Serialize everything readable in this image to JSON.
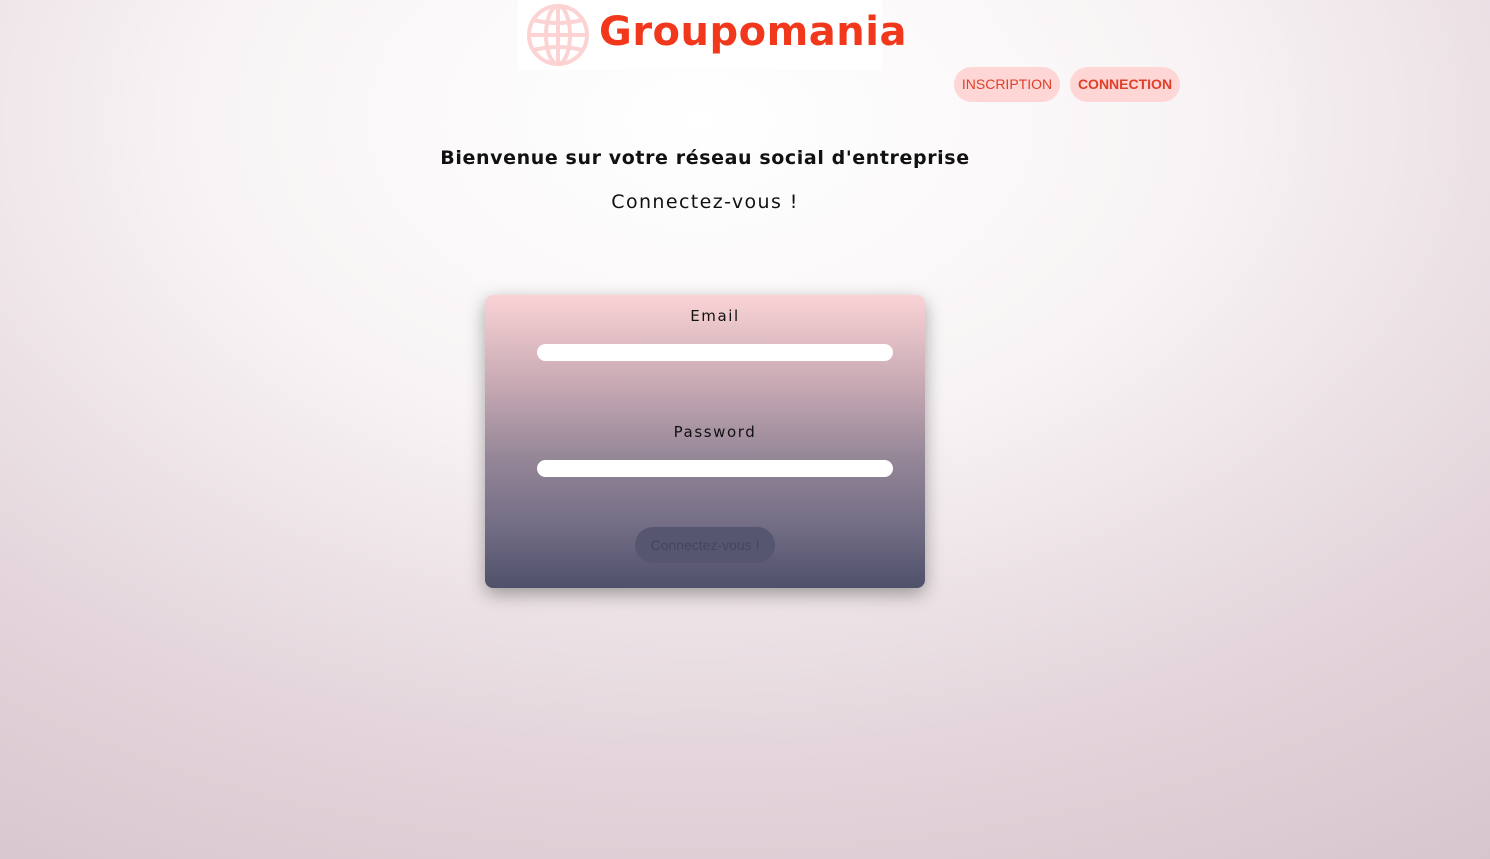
{
  "brand": {
    "name": "Groupomania",
    "color": "#f2381c",
    "logo_icon": "globe-icon"
  },
  "nav": {
    "inscription_label": "INSCRIPTION",
    "connection_label": "CONNECTION"
  },
  "main": {
    "welcome": "Bienvenue sur votre réseau social d'entreprise",
    "subtitle": "Connectez-vous !"
  },
  "form": {
    "email_label": "Email",
    "email_value": "",
    "password_label": "Password",
    "password_value": "",
    "submit_label": "Connectez-vous !"
  },
  "colors": {
    "nav_button_bg": "#ffd6d6",
    "nav_button_text": "#e0402a",
    "card_gradient_top": "#fad3d5",
    "card_gradient_bottom": "#4f506a"
  }
}
